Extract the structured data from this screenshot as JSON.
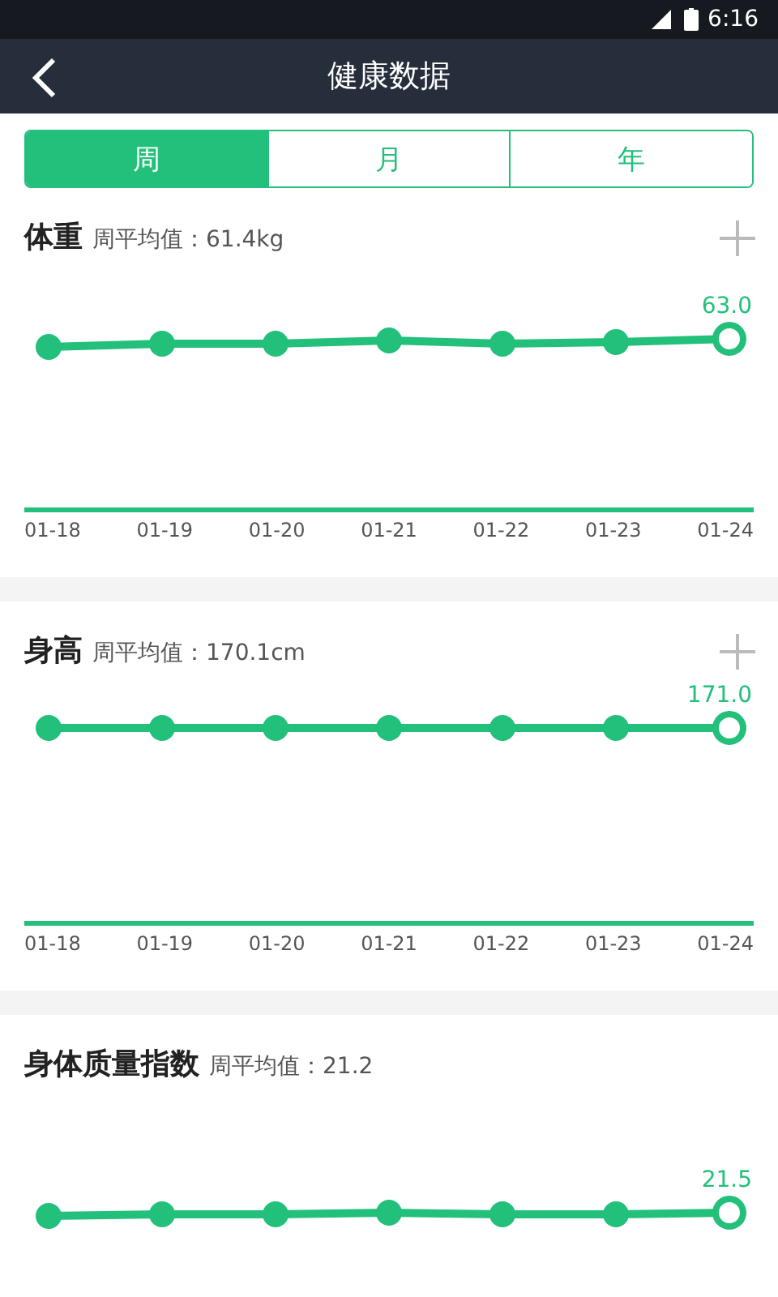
{
  "status_bar": {
    "time": "6:16"
  },
  "header": {
    "title": "健康数据"
  },
  "tabs": [
    {
      "label": "周",
      "selected": true
    },
    {
      "label": "月",
      "selected": false
    },
    {
      "label": "年",
      "selected": false
    }
  ],
  "cards": [
    {
      "title": "体重",
      "average": "周平均值：61.4kg",
      "add_button": true,
      "last_value": "63.0",
      "dates": [
        "01-18",
        "01-19",
        "01-20",
        "01-21",
        "01-22",
        "01-23",
        "01-24"
      ]
    },
    {
      "title": "身高",
      "average": "周平均值：170.1cm",
      "add_button": true,
      "last_value": "171.0",
      "dates": [
        "01-18",
        "01-19",
        "01-20",
        "01-21",
        "01-22",
        "01-23",
        "01-24"
      ]
    },
    {
      "title": "身体质量指数",
      "average": "周平均值：21.2",
      "add_button": false,
      "last_value": "21.5"
    }
  ]
}
